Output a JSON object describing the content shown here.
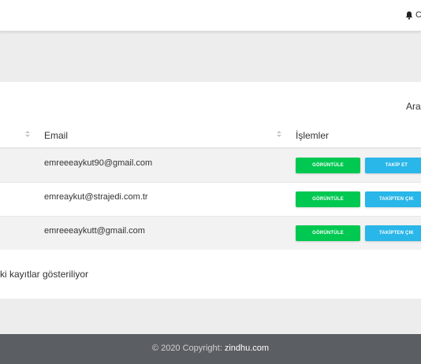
{
  "topbar": {
    "text": "C"
  },
  "table": {
    "search_label": "Ara:",
    "columns": {
      "email": "Email",
      "actions": "İşlemler"
    },
    "rows": [
      {
        "email": "emreeeaykut90@gmail.com",
        "view_label": "GÖRÜNTÜLE",
        "follow_label": "TAKİP ET"
      },
      {
        "email": "emreaykut@strajedi.com.tr",
        "view_label": "GÖRÜNTÜLE",
        "follow_label": "TAKİPTEN ÇIK"
      },
      {
        "email": "emreeeaykutt@gmail.com",
        "view_label": "GÖRÜNTÜLE",
        "follow_label": "TAKİPTEN ÇIK"
      }
    ],
    "info": "ki kayıtlar gösteriliyor"
  },
  "footer": {
    "prefix": "© 2020 Copyright: ",
    "link": "zindhu.com"
  },
  "colors": {
    "view_button": "#00c851",
    "follow_button": "#29b6e8",
    "footer_bg": "#5b5e63"
  },
  "icons": {
    "bell": "bell-icon",
    "sort": "sort-icon"
  }
}
